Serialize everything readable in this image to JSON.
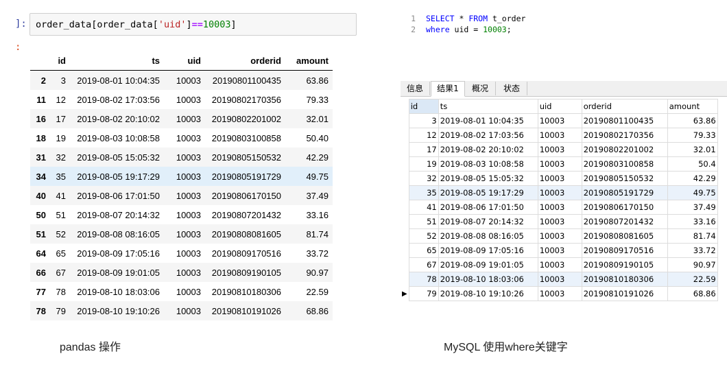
{
  "jupyter": {
    "in_prompt": "]:",
    "out_prompt": ":",
    "code_parts": [
      "order_data[order_data[",
      "'uid'",
      "]",
      "==",
      "10003",
      "]"
    ],
    "columns": [
      "id",
      "ts",
      "uid",
      "orderid",
      "amount"
    ],
    "rows": [
      {
        "index": "2",
        "id": "3",
        "ts": "2019-08-01 10:04:35",
        "uid": "10003",
        "orderid": "20190801100435",
        "amount": "63.86"
      },
      {
        "index": "11",
        "id": "12",
        "ts": "2019-08-02 17:03:56",
        "uid": "10003",
        "orderid": "20190802170356",
        "amount": "79.33"
      },
      {
        "index": "16",
        "id": "17",
        "ts": "2019-08-02 20:10:02",
        "uid": "10003",
        "orderid": "20190802201002",
        "amount": "32.01"
      },
      {
        "index": "18",
        "id": "19",
        "ts": "2019-08-03 10:08:58",
        "uid": "10003",
        "orderid": "20190803100858",
        "amount": "50.40"
      },
      {
        "index": "31",
        "id": "32",
        "ts": "2019-08-05 15:05:32",
        "uid": "10003",
        "orderid": "20190805150532",
        "amount": "42.29"
      },
      {
        "index": "34",
        "id": "35",
        "ts": "2019-08-05 19:17:29",
        "uid": "10003",
        "orderid": "20190805191729",
        "amount": "49.75"
      },
      {
        "index": "40",
        "id": "41",
        "ts": "2019-08-06 17:01:50",
        "uid": "10003",
        "orderid": "20190806170150",
        "amount": "37.49"
      },
      {
        "index": "50",
        "id": "51",
        "ts": "2019-08-07 20:14:32",
        "uid": "10003",
        "orderid": "20190807201432",
        "amount": "33.16"
      },
      {
        "index": "51",
        "id": "52",
        "ts": "2019-08-08 08:16:05",
        "uid": "10003",
        "orderid": "20190808081605",
        "amount": "81.74"
      },
      {
        "index": "64",
        "id": "65",
        "ts": "2019-08-09 17:05:16",
        "uid": "10003",
        "orderid": "20190809170516",
        "amount": "33.72"
      },
      {
        "index": "66",
        "id": "67",
        "ts": "2019-08-09 19:01:05",
        "uid": "10003",
        "orderid": "20190809190105",
        "amount": "90.97"
      },
      {
        "index": "77",
        "id": "78",
        "ts": "2019-08-10 18:03:06",
        "uid": "10003",
        "orderid": "20190810180306",
        "amount": "22.59"
      },
      {
        "index": "78",
        "id": "79",
        "ts": "2019-08-10 19:10:26",
        "uid": "10003",
        "orderid": "20190810191026",
        "amount": "68.86"
      }
    ],
    "highlighted_row_index": "34",
    "caption": "pandas 操作"
  },
  "navicat": {
    "line_numbers": [
      "1",
      "2"
    ],
    "sql_line1": {
      "select": "SELECT",
      "star": " * ",
      "from": "FROM",
      "table": " t_order"
    },
    "sql_line2": {
      "where": "where",
      "cond": " uid = ",
      "value": "10003",
      "end": ";"
    },
    "tabs": [
      "信息",
      "结果1",
      "概况",
      "状态"
    ],
    "active_tab": "结果1",
    "columns": [
      "id",
      "ts",
      "uid",
      "orderid",
      "amount"
    ],
    "rows": [
      {
        "id": "3",
        "ts": "2019-08-01 10:04:35",
        "uid": "10003",
        "orderid": "20190801100435",
        "amount": "63.86"
      },
      {
        "id": "12",
        "ts": "2019-08-02 17:03:56",
        "uid": "10003",
        "orderid": "20190802170356",
        "amount": "79.33"
      },
      {
        "id": "17",
        "ts": "2019-08-02 20:10:02",
        "uid": "10003",
        "orderid": "20190802201002",
        "amount": "32.01"
      },
      {
        "id": "19",
        "ts": "2019-08-03 10:08:58",
        "uid": "10003",
        "orderid": "20190803100858",
        "amount": "50.4"
      },
      {
        "id": "32",
        "ts": "2019-08-05 15:05:32",
        "uid": "10003",
        "orderid": "20190805150532",
        "amount": "42.29"
      },
      {
        "id": "35",
        "ts": "2019-08-05 19:17:29",
        "uid": "10003",
        "orderid": "20190805191729",
        "amount": "49.75"
      },
      {
        "id": "41",
        "ts": "2019-08-06 17:01:50",
        "uid": "10003",
        "orderid": "20190806170150",
        "amount": "37.49"
      },
      {
        "id": "51",
        "ts": "2019-08-07 20:14:32",
        "uid": "10003",
        "orderid": "20190807201432",
        "amount": "33.16"
      },
      {
        "id": "52",
        "ts": "2019-08-08 08:16:05",
        "uid": "10003",
        "orderid": "20190808081605",
        "amount": "81.74"
      },
      {
        "id": "65",
        "ts": "2019-08-09 17:05:16",
        "uid": "10003",
        "orderid": "20190809170516",
        "amount": "33.72"
      },
      {
        "id": "67",
        "ts": "2019-08-09 19:01:05",
        "uid": "10003",
        "orderid": "20190809190105",
        "amount": "90.97"
      },
      {
        "id": "78",
        "ts": "2019-08-10 18:03:06",
        "uid": "10003",
        "orderid": "20190810180306",
        "amount": "22.59"
      },
      {
        "id": "79",
        "ts": "2019-08-10 19:10:26",
        "uid": "10003",
        "orderid": "20190810191026",
        "amount": "68.86"
      }
    ],
    "highlighted_row_ids": [
      "35",
      "78"
    ],
    "current_row_id": "79",
    "row_indicator_icon": "triangle-right-icon",
    "caption": "MySQL 使用where关键字"
  }
}
